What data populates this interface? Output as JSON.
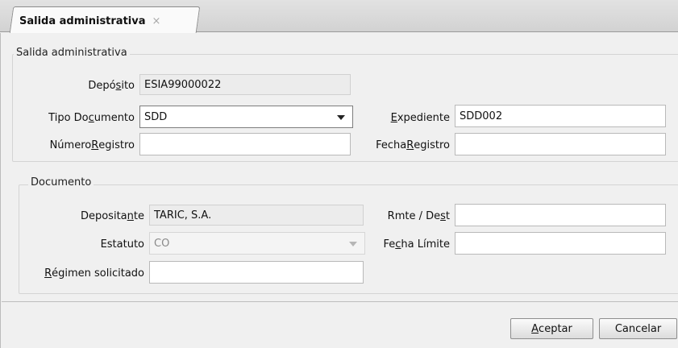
{
  "tab": {
    "title": "Salida administrativa",
    "close_glyph": "×"
  },
  "group_salida": {
    "legend": "Salida administrativa"
  },
  "deposito": {
    "label_a": "Depó",
    "label_u": "s",
    "label_b": "ito",
    "value": "ESIA99000022"
  },
  "tipo_documento": {
    "label_a": "Tipo Do",
    "label_u": "c",
    "label_b": "umento",
    "value": "SDD"
  },
  "expediente": {
    "label_a": "",
    "label_u": "E",
    "label_b": "xpediente",
    "value": "SDD002"
  },
  "numero_registro": {
    "label_a": "Número ",
    "label_u": "R",
    "label_b": "egistro",
    "value": ""
  },
  "fecha_registro": {
    "label_a": "Fecha ",
    "label_u": "R",
    "label_b": "egistro",
    "value": ""
  },
  "group_documento": {
    "legend": "Documento"
  },
  "depositante": {
    "label_a": "Deposita",
    "label_u": "n",
    "label_b": "te",
    "value": "TARIC, S.A."
  },
  "rmte_dest": {
    "label_a": "Rmte / De",
    "label_u": "s",
    "label_b": "t",
    "value": ""
  },
  "estatuto": {
    "label": "Estatuto",
    "value": "CO"
  },
  "fecha_limite": {
    "label_a": "Fe",
    "label_u": "c",
    "label_b": "ha Límite",
    "value": ""
  },
  "regimen": {
    "label_a": "",
    "label_u": "R",
    "label_b": "égimen solicitado",
    "value": ""
  },
  "buttons": {
    "accept": {
      "u": "A",
      "rest": "ceptar"
    },
    "cancel": {
      "label": "Cancelar"
    }
  }
}
